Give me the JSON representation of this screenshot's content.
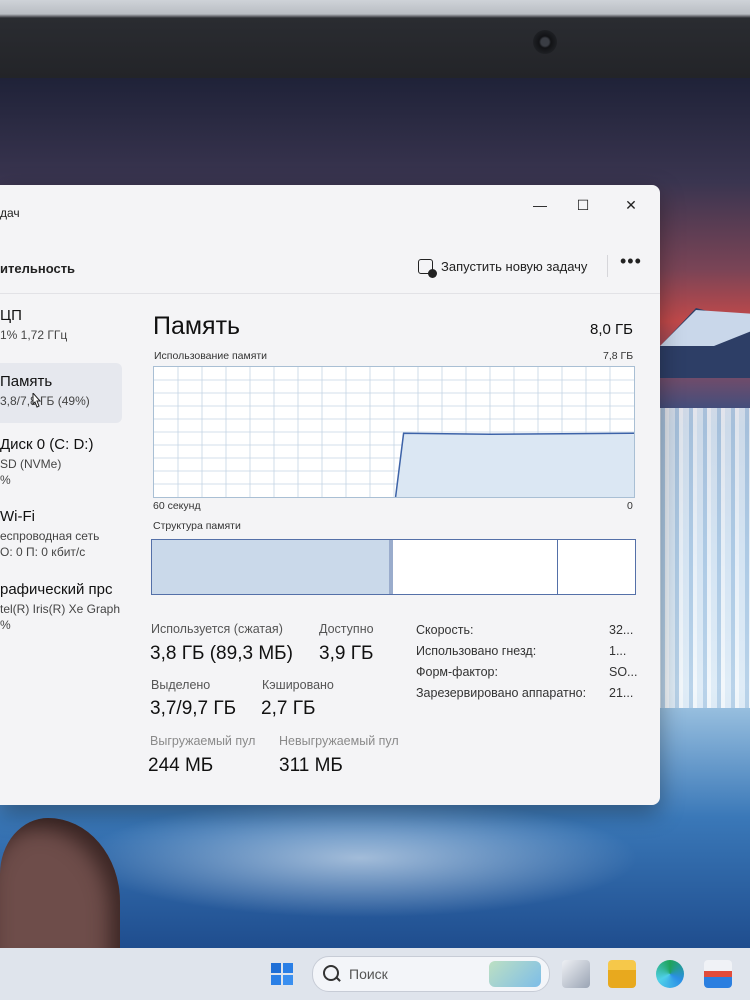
{
  "window": {
    "title": "дач",
    "heading": "ительность",
    "run_task_label": "Запустить новую задачу",
    "more_label": "•••",
    "controls": {
      "minimize": "—",
      "maximize": "☐",
      "close": "✕"
    }
  },
  "sidebar": {
    "items": [
      {
        "name": "ЦП",
        "sub1": "1%  1,72 ГГц",
        "sub2": ""
      },
      {
        "name": "Память",
        "sub1": "3,8/7,8 ГБ (49%)",
        "sub2": ""
      },
      {
        "name": "Диск 0 (C: D:)",
        "sub1": "SD (NVMe)",
        "sub2": "%"
      },
      {
        "name": "Wi-Fi",
        "sub1": "еспроводная сеть",
        "sub2": "О: 0 П: 0 кбит/с"
      },
      {
        "name": "рафический прс",
        "sub1": "tel(R) Iris(R) Xe Graph",
        "sub2": "%"
      }
    ]
  },
  "memory": {
    "title": "Память",
    "total": "8,0 ГБ",
    "usage_label": "Использование памяти",
    "usage_max": "7,8 ГБ",
    "graph_left": "60 секунд",
    "graph_right": "0",
    "usage_fraction_recent": 0.49,
    "structure_label": "Структура памяти",
    "structure": {
      "in_use": 0.49,
      "modified": 0.01,
      "standby": 0.34,
      "free": 0.16
    },
    "stats": {
      "in_use_label": "Используется (сжатая)",
      "in_use_value": "3,8 ГБ (89,3 МБ)",
      "available_label": "Доступно",
      "available_value": "3,9 ГБ",
      "committed_label": "Выделено",
      "committed_value": "3,7/9,7 ГБ",
      "cached_label": "Кэшировано",
      "cached_value": "2,7 ГБ",
      "paged_label": "Выгружаемый пул",
      "paged_value": "244 МБ",
      "nonpaged_label": "Невыгружаемый пул",
      "nonpaged_value": "311 МБ"
    },
    "details": [
      {
        "label": "Скорость:",
        "value": "32..."
      },
      {
        "label": "Использовано гнезд:",
        "value": "1..."
      },
      {
        "label": "Форм-фактор:",
        "value": "SO..."
      },
      {
        "label": "Зарезервировано аппаратно:",
        "value": "21..."
      }
    ]
  },
  "taskbar": {
    "search_placeholder": "Поиск"
  },
  "colors": {
    "graph_fill": "#dbe7f3",
    "graph_line": "#3d63a8",
    "graph_grid": "#c4d4e4",
    "structure_used": "#cad9ea"
  }
}
